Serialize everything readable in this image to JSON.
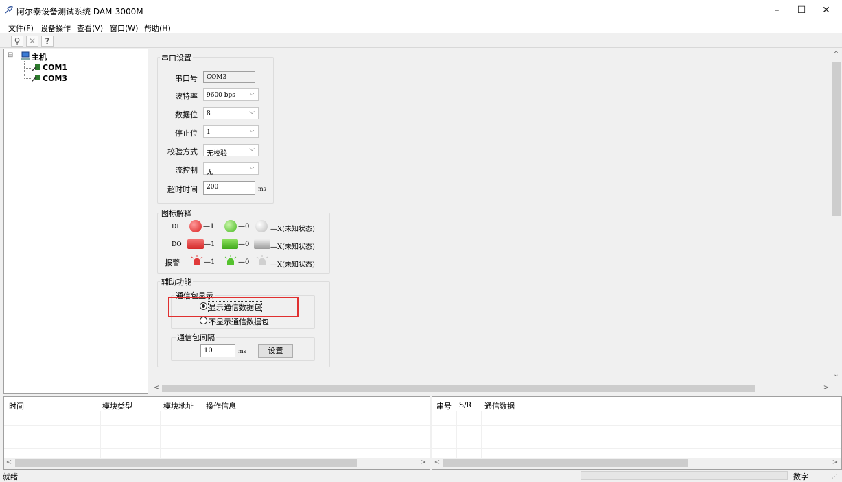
{
  "window": {
    "title": "阿尔泰设备测试系统 DAM-3000M",
    "minimize_glyph": "–",
    "maximize_glyph": "☐",
    "close_glyph": "✕"
  },
  "menu": {
    "items": [
      "文件(F)",
      "设备操作",
      "查看(V)",
      "窗口(W)",
      "帮助(H)"
    ]
  },
  "toolbar": {
    "icons": [
      "search-icon",
      "close-icon",
      "help-icon"
    ],
    "glyphs": [
      "⚲",
      "✕",
      "?"
    ]
  },
  "tree": {
    "collapse_glyph": "⊟",
    "root_label": "主机",
    "children": [
      "COM1",
      "COM3"
    ]
  },
  "serial": {
    "group_title": "串口设置",
    "port_label": "串口号",
    "port_value": "COM3",
    "baud_label": "波特率",
    "baud_value": "9600 bps",
    "databits_label": "数据位",
    "databits_value": "8",
    "stopbits_label": "停止位",
    "stopbits_value": "1",
    "parity_label": "校验方式",
    "parity_value": "无校验",
    "flow_label": "流控制",
    "flow_value": "无",
    "timeout_label": "超时时间",
    "timeout_value": "200",
    "timeout_unit": "ms",
    "dropdown_glyph": "⌵"
  },
  "legend": {
    "group_title": "图标解释",
    "di_label": "DI",
    "do_label": "DO",
    "alarm_label": "报警",
    "one": "—1",
    "zero": "—0",
    "unknown": "—X(未知状态)",
    "colors": {
      "red": "#e03a3a",
      "green": "#55c22e",
      "gray": "#c8c8c8"
    }
  },
  "aux": {
    "group_title": "辅助功能",
    "display_group_title": "通信包显示",
    "show_packets": "显示通信数据包",
    "hide_packets": "不显示通信数据包",
    "selected": "show",
    "interval_group_title": "通信包间隔",
    "interval_value": "10",
    "interval_unit": "ms",
    "set_button": "设置",
    "highlight_color": "#e03030"
  },
  "log_panel": {
    "columns": [
      "时间",
      "模块类型",
      "模块地址",
      "操作信息"
    ]
  },
  "comm_panel": {
    "columns": [
      "串号",
      "S/R",
      "通信数据"
    ]
  },
  "scroll": {
    "up": "^",
    "down": "⌄",
    "left": "<",
    "right": ">"
  },
  "status": {
    "ready": "就绪",
    "numlock": "数字"
  }
}
